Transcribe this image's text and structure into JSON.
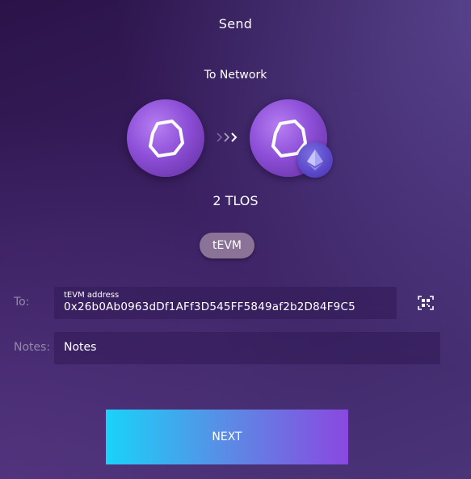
{
  "header": {
    "title": "Send"
  },
  "transfer": {
    "to_network_label": "To Network",
    "from_icon": "telos-icon",
    "to_icon": "telos-icon",
    "badge_icon": "ethereum-icon",
    "arrows_icon": "chevrons-right-icon",
    "amount": "2 TLOS",
    "network_chip": "tEVM"
  },
  "form": {
    "to_label": "To:",
    "address_label": "tEVM address",
    "address_value": "0x26b0Ab0963dDf1AFf3D545FF5849af2b2D84F9C5",
    "qr_icon": "qr-scan-icon",
    "notes_label": "Notes:",
    "notes_placeholder": "Notes"
  },
  "actions": {
    "next_label": "NEXT"
  },
  "colors": {
    "accent_gradient_start": "#19d3f9",
    "accent_gradient_end": "#8a48e0",
    "coin_purple": "#8d4fd8",
    "chip_bg": "#8b7397"
  }
}
